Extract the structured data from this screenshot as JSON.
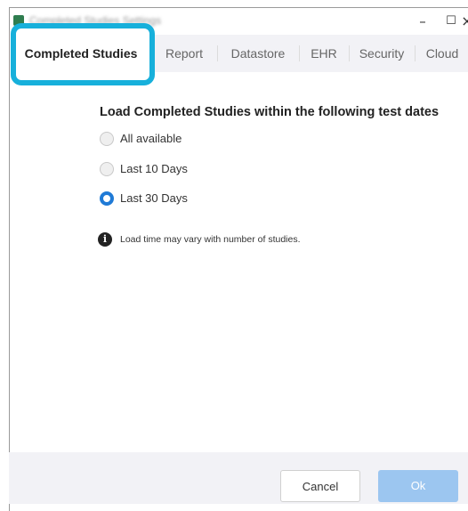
{
  "window": {
    "title": "Completed Studies Settings",
    "controls": {
      "minimize": "–",
      "maximize": "☐",
      "close": "×"
    }
  },
  "tabs": [
    {
      "label": "Completed Studies",
      "active": true
    },
    {
      "label": "Report",
      "active": false
    },
    {
      "label": "Datastore",
      "active": false
    },
    {
      "label": "EHR",
      "active": false
    },
    {
      "label": "Security",
      "active": false
    },
    {
      "label": "Cloud",
      "active": false
    }
  ],
  "main": {
    "heading": "Load Completed Studies within the following test dates",
    "options": [
      {
        "label": "All available",
        "checked": false
      },
      {
        "label": "Last 10 Days",
        "checked": false
      },
      {
        "label": "Last 30 Days",
        "checked": true
      }
    ],
    "info_icon": "info-icon",
    "info_text": "Load time may vary with number of studies."
  },
  "footer": {
    "cancel_label": "Cancel",
    "ok_label": "Ok"
  },
  "colors": {
    "accent": "#1f7ad6",
    "highlight": "#17b0db",
    "ok_disabled": "#9cc6f0",
    "tabbar_bg": "#f2f2f6"
  }
}
